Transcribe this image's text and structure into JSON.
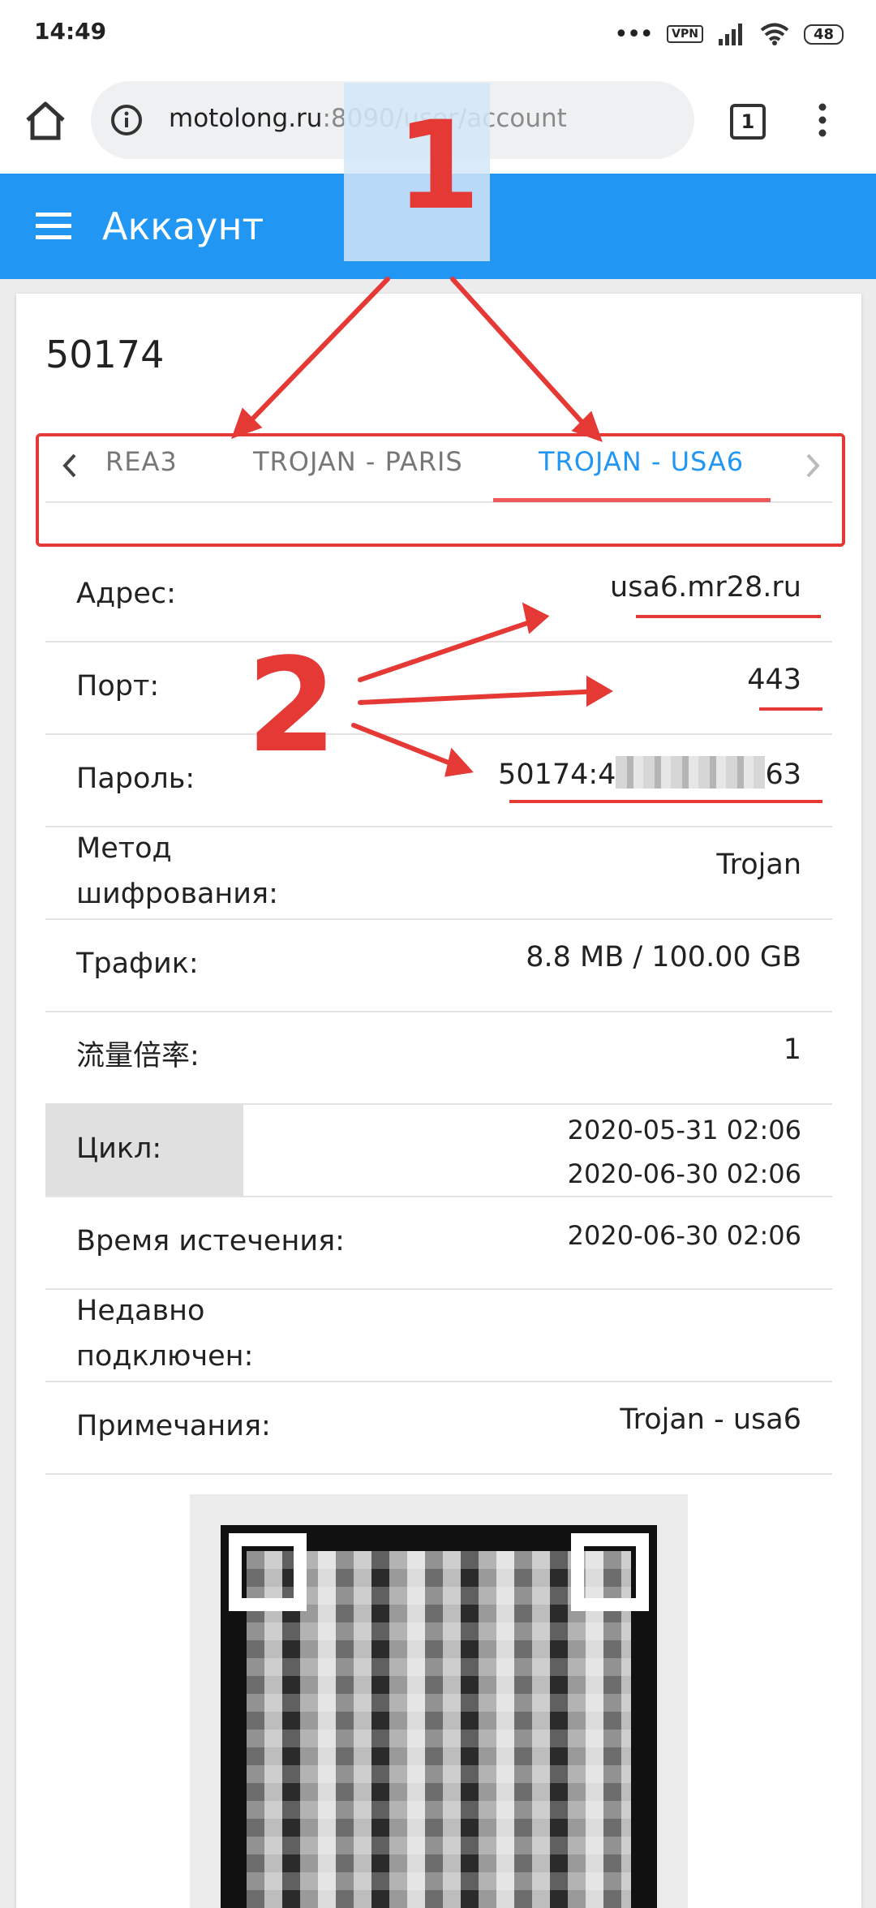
{
  "status_bar": {
    "time": "14:49",
    "vpn_label": "VPN",
    "battery": "48",
    "icons": [
      "dots-icon",
      "signal-icon",
      "wifi-icon",
      "battery-icon"
    ]
  },
  "browser": {
    "url_host": "motolong.ru",
    "url_rest": ":8090/user/account",
    "tab_count": "1",
    "icons": [
      "home-icon",
      "info-icon",
      "tabs-icon",
      "menu-dots-icon"
    ]
  },
  "appbar": {
    "title": "Аккаунт",
    "icons": [
      "hamburger-icon"
    ]
  },
  "account": {
    "id": "50174",
    "tabs": [
      {
        "label": "REA3"
      },
      {
        "label": "TROJAN - PARIS"
      },
      {
        "label": "TROJAN - USA6"
      }
    ],
    "active_tab_index": 2,
    "fields": [
      {
        "label": "Адрес:",
        "value": "usa6.mr28.ru"
      },
      {
        "label": "Порт:",
        "value": "443"
      },
      {
        "label": "Пароль:",
        "value_start": "50174:4",
        "value_end": "63"
      },
      {
        "label_line1": "Метод",
        "label_line2": "шифрования:",
        "value": "Trojan"
      },
      {
        "label": "Трафик:",
        "value": "8.8 MB / 100.00 GB"
      },
      {
        "label": "流量倍率:",
        "value": "1"
      },
      {
        "label": "Цикл:",
        "value_line1": "2020-05-31 02:06",
        "value_line2": "2020-06-30 02:06"
      },
      {
        "label": "Время истечения:",
        "value": "2020-06-30 02:06"
      },
      {
        "label_line1": "Недавно",
        "label_line2": "подключен:",
        "value": ""
      },
      {
        "label": "Примечания:",
        "value": "Trojan - usa6"
      }
    ]
  },
  "annotations": {
    "marker_one": "1",
    "marker_two": "2",
    "color": "#e53935"
  },
  "colors": {
    "primary": "#2196f3",
    "accent_red": "#f05a5a"
  }
}
